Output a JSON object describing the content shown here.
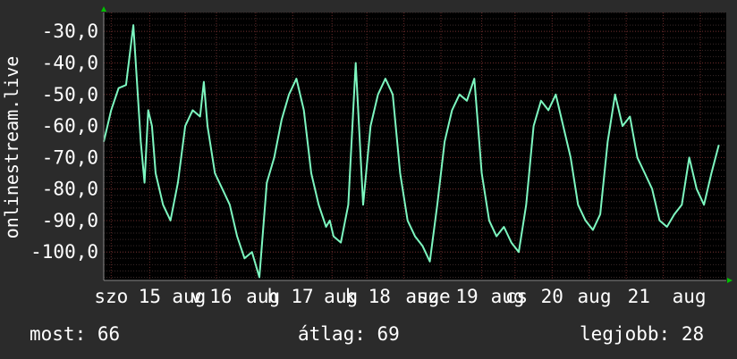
{
  "colors": {
    "background": "#2b2b2b",
    "plot_background": "#000000",
    "grid_minor": "#3a2a2a",
    "grid_major": "#6a2a2a",
    "line": "#7df7c0",
    "axis_arrow": "#00c000",
    "text": "#ffffff"
  },
  "footer": {
    "current_label": "most:",
    "current_value": "66",
    "average_label": "átlag:",
    "average_value": "69",
    "best_label": "legjobb:",
    "best_value": "28"
  },
  "chart_data": {
    "type": "line",
    "title": "",
    "xlabel": "",
    "ylabel": "onlinestream.live",
    "ylim": [
      -109,
      -24
    ],
    "xlim": [
      0,
      8.4
    ],
    "y_ticks": [
      -30,
      -40,
      -50,
      -60,
      -70,
      -80,
      -90,
      -100
    ],
    "y_tick_labels": [
      "-30,0",
      "-40,0",
      "-50,0",
      "-60,0",
      "-70,0",
      "-80,0",
      "-90,0",
      "-100,0"
    ],
    "x_ticks": [
      0.1,
      0.62,
      1.1,
      1.52,
      2.05,
      2.55,
      3.08,
      3.55,
      4.05,
      4.55,
      5.1,
      5.55,
      6.05,
      6.55,
      7.05,
      7.55,
      8.05
    ],
    "x_tick_labels": [
      "szo",
      "15",
      "aug",
      "v",
      "16",
      "aug",
      "h",
      "17",
      "aug",
      "k",
      "18",
      "aug",
      "sze",
      "19",
      "aug",
      "cs",
      "20",
      "aug",
      "21",
      "aug"
    ],
    "x_tick_label_positions": [
      0.1,
      0.62,
      1.15,
      1.25,
      1.58,
      2.15,
      2.28,
      2.68,
      3.2,
      3.33,
      3.72,
      4.3,
      4.45,
      4.9,
      5.45,
      5.57,
      6.05,
      6.62,
      7.22,
      7.9
    ],
    "grid": true,
    "legend": "none",
    "series": [
      {
        "name": "",
        "x": [
          0.0,
          0.1,
          0.2,
          0.3,
          0.4,
          0.5,
          0.55,
          0.6,
          0.65,
          0.7,
          0.8,
          0.9,
          1.0,
          1.1,
          1.2,
          1.3,
          1.35,
          1.4,
          1.5,
          1.6,
          1.7,
          1.8,
          1.9,
          2.0,
          2.1,
          2.2,
          2.3,
          2.4,
          2.5,
          2.6,
          2.7,
          2.8,
          2.9,
          3.0,
          3.05,
          3.1,
          3.2,
          3.3,
          3.4,
          3.5,
          3.6,
          3.7,
          3.8,
          3.9,
          4.0,
          4.1,
          4.2,
          4.3,
          4.4,
          4.5,
          4.6,
          4.7,
          4.8,
          4.9,
          5.0,
          5.1,
          5.2,
          5.3,
          5.4,
          5.5,
          5.6,
          5.7,
          5.8,
          5.9,
          6.0,
          6.1,
          6.2,
          6.3,
          6.4,
          6.5,
          6.6,
          6.7,
          6.8,
          6.9,
          7.0,
          7.1,
          7.2,
          7.3,
          7.4,
          7.5,
          7.6,
          7.7,
          7.8,
          7.9,
          8.0,
          8.1,
          8.2,
          8.3
        ],
        "values": [
          -65,
          -55,
          -48,
          -47,
          -28,
          -65,
          -78,
          -55,
          -60,
          -75,
          -85,
          -90,
          -78,
          -60,
          -55,
          -57,
          -46,
          -60,
          -75,
          -80,
          -85,
          -95,
          -102,
          -100,
          -108,
          -78,
          -70,
          -58,
          -50,
          -45,
          -55,
          -75,
          -85,
          -92,
          -90,
          -95,
          -97,
          -85,
          -40,
          -85,
          -60,
          -50,
          -45,
          -50,
          -75,
          -90,
          -95,
          -98,
          -103,
          -85,
          -65,
          -55,
          -50,
          -52,
          -45,
          -75,
          -90,
          -95,
          -92,
          -97,
          -100,
          -85,
          -60,
          -52,
          -55,
          -50,
          -60,
          -70,
          -85,
          -90,
          -93,
          -88,
          -65,
          -50,
          -60,
          -57,
          -70,
          -75,
          -80,
          -90,
          -92,
          -88,
          -85,
          -70,
          -80,
          -85,
          -75,
          -66
        ]
      }
    ]
  }
}
